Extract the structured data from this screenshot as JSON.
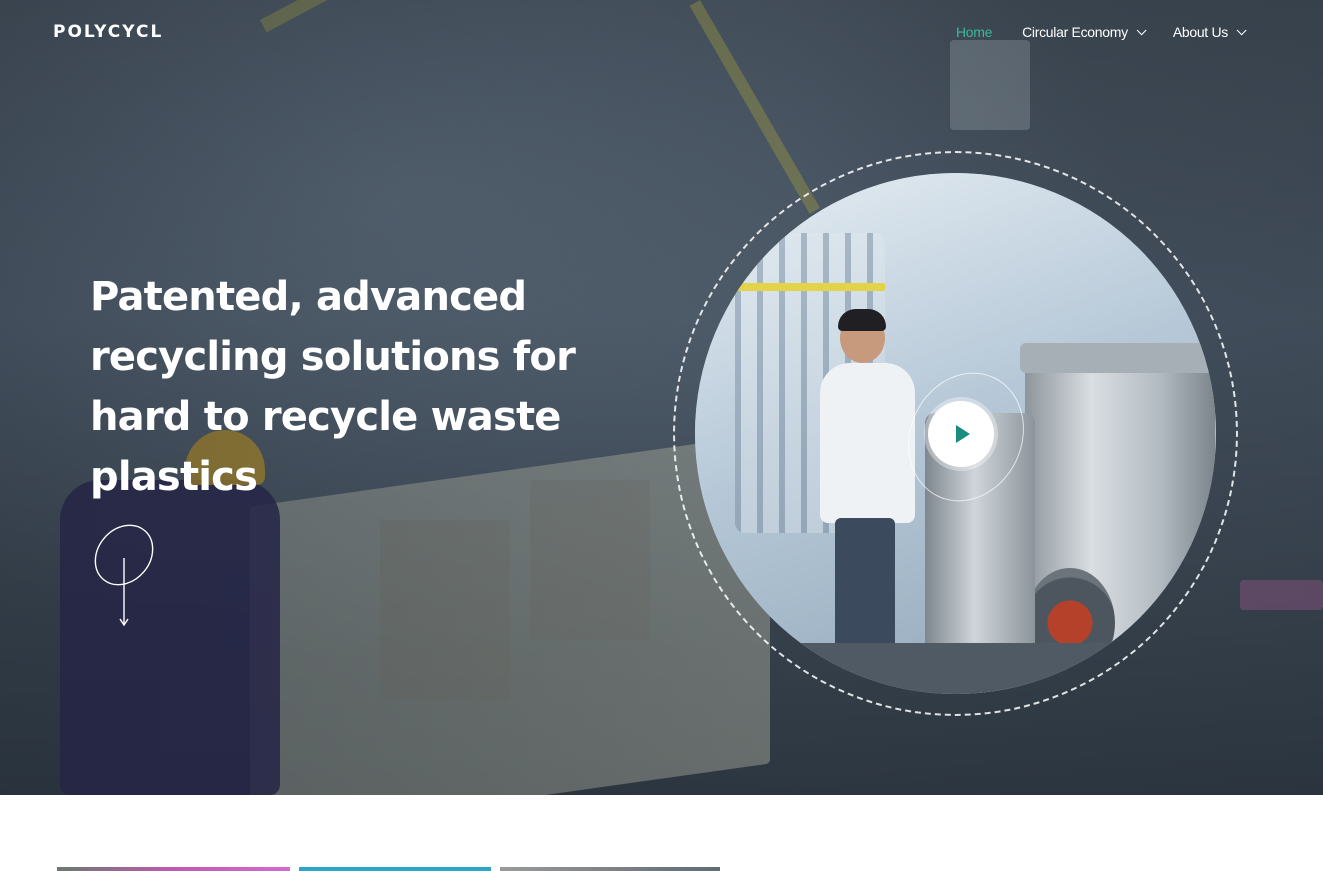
{
  "brand": {
    "logo_text": "POLYCYCL"
  },
  "nav": {
    "items": [
      {
        "label": "Home",
        "active": true,
        "has_dropdown": false
      },
      {
        "label": "Circular Economy",
        "active": false,
        "has_dropdown": true
      },
      {
        "label": "About Us",
        "active": false,
        "has_dropdown": true
      }
    ]
  },
  "hero": {
    "headline": "Patented, advanced recycling solutions for hard to recycle waste plastics",
    "video": {
      "play_icon": "play-icon"
    },
    "scroll_icon": "scroll-down-icon"
  },
  "colors": {
    "accent": "#3fb59b",
    "play_icon": "#1b8c7c",
    "text_on_dark": "#ffffff"
  }
}
